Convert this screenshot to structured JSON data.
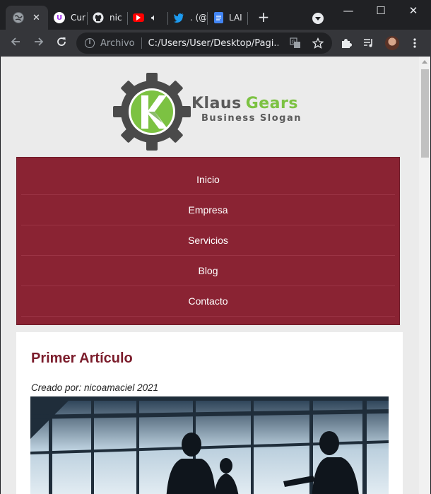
{
  "browser": {
    "tabs": [
      {
        "title": "",
        "favicon": "globe-icon",
        "active": true
      },
      {
        "title": "Cur",
        "favicon": "udemy-icon"
      },
      {
        "title": "nic",
        "favicon": "github-icon"
      },
      {
        "title": "",
        "favicon": "youtube-icon",
        "audio": true
      },
      {
        "title": ". (@",
        "favicon": "twitter-icon"
      },
      {
        "title": "LAI",
        "favicon": "docs-icon"
      }
    ],
    "new_tab_label": "+",
    "omnibox": {
      "scheme_label": "Archivo",
      "url": "C:/Users/User/Desktop/Pagi..."
    },
    "window_controls": {
      "minimize": "—",
      "maximize": "☐",
      "close": "✕"
    }
  },
  "site": {
    "logo": {
      "brand_word1": "Klaus",
      "brand_word2": "Gears",
      "slogan": "Business Slogan"
    },
    "nav": [
      "Inicio",
      "Empresa",
      "Servicios",
      "Blog",
      "Contacto"
    ],
    "article": {
      "title": "Primer Artículo",
      "meta": "Creado por: nicoamaciel 2021"
    }
  },
  "colors": {
    "nav_bg": "#8a2333",
    "title_color": "#7b1c2b",
    "logo_green": "#7cc242",
    "logo_gray": "#5a5a5a",
    "page_bg": "#ebebeb"
  }
}
